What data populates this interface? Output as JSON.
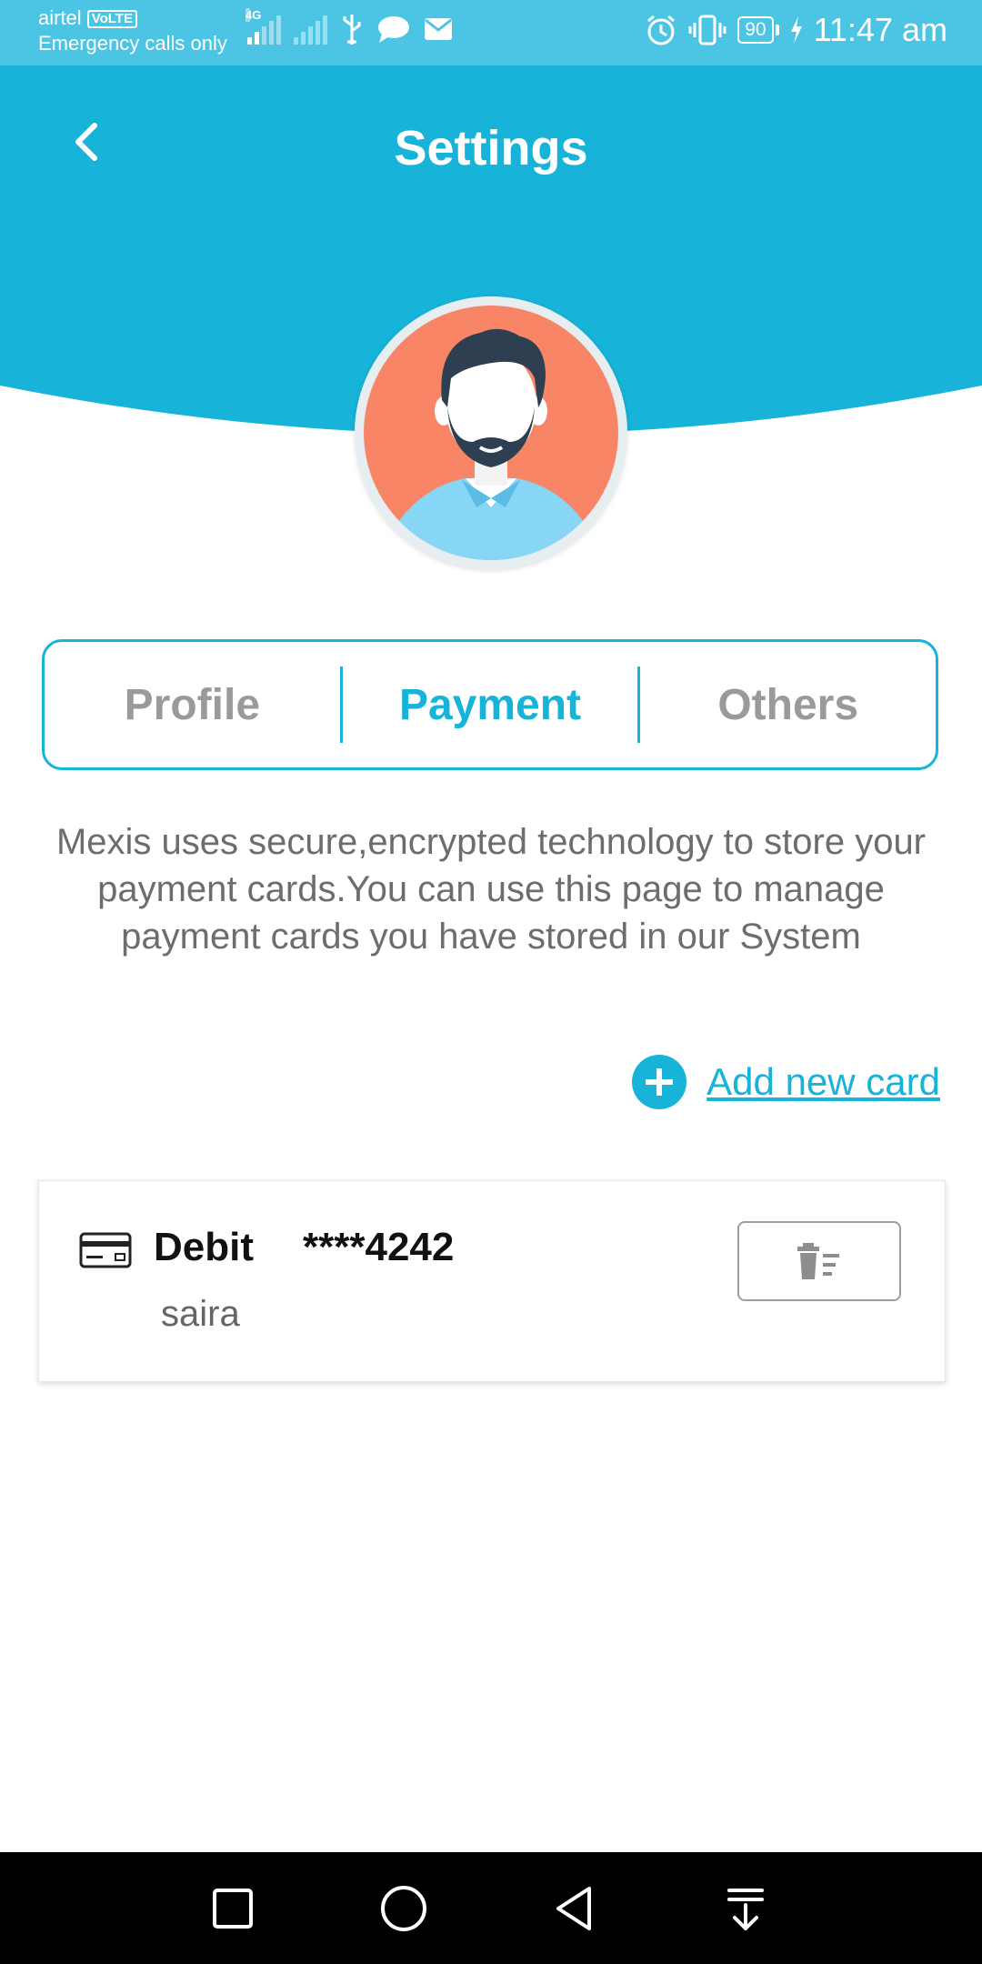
{
  "status_bar": {
    "carrier": "airtel",
    "volte": "VoLTE",
    "network_note": "Emergency calls only",
    "signal_tag": "4G",
    "battery": "90",
    "time": "11:47 am"
  },
  "header": {
    "title": "Settings",
    "color": "#17b3d9"
  },
  "tabs": [
    {
      "label": "Profile",
      "active": false
    },
    {
      "label": "Payment",
      "active": true
    },
    {
      "label": "Others",
      "active": false
    }
  ],
  "payment": {
    "description": "Mexis uses secure,encrypted technology to store your payment cards.You can use this page to manage payment cards you have stored in our System",
    "add_card_label": "Add new card",
    "cards": [
      {
        "type": "Debit",
        "number": "****4242",
        "holder": "saira"
      }
    ]
  },
  "nav_bar": {
    "icons": [
      "recent-apps-icon",
      "home-icon",
      "back-icon",
      "notification-pull-icon"
    ]
  },
  "colors": {
    "accent": "#17b3d9",
    "status_bar": "#4cc4e3",
    "avatar_bg": "#f78566"
  }
}
